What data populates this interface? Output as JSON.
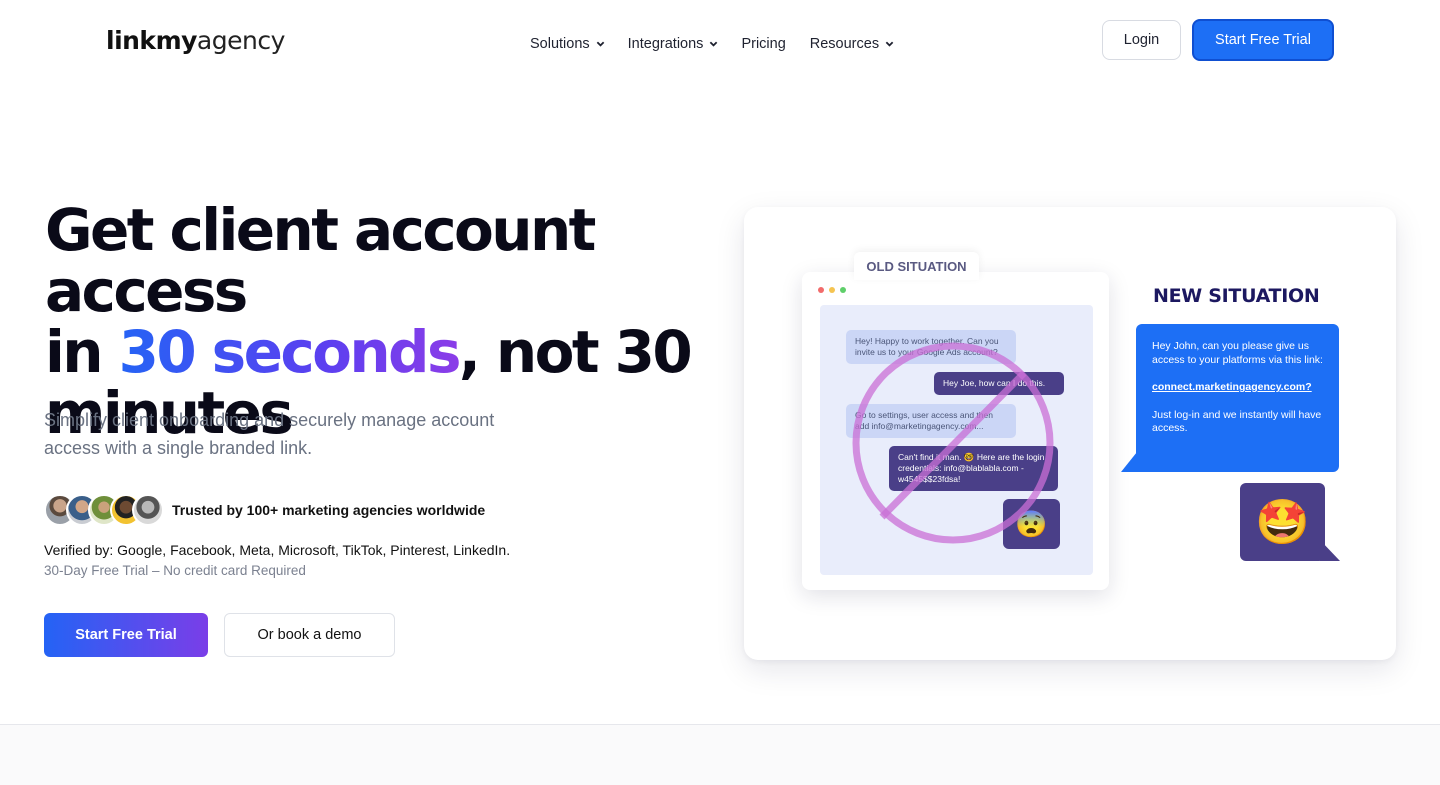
{
  "header": {
    "logo_bold": "linkmy",
    "logo_light": "agency",
    "nav": [
      {
        "label": "Solutions",
        "dropdown": true
      },
      {
        "label": "Integrations",
        "dropdown": true
      },
      {
        "label": "Pricing",
        "dropdown": false
      },
      {
        "label": "Resources",
        "dropdown": true
      }
    ],
    "login_label": "Login",
    "trial_label": "Start Free Trial"
  },
  "hero": {
    "title_line1": "Get client account access",
    "title_in": "in ",
    "title_highlight": "30 seconds",
    "title_rest": ", not 30",
    "title_line3": "minutes",
    "subtitle": "Simplify client onboarding and securely manage account access with a single branded link.",
    "trusted_text": "Trusted by 100+ marketing agencies worldwide",
    "verified_text": "Verified by: Google, Facebook, Meta, Microsoft, TikTok, Pinterest, LinkedIn.",
    "trial_note": "30-Day Free Trial – No credit card Required",
    "cta_primary": "Start Free Trial",
    "cta_secondary": "Or book a demo"
  },
  "illustration": {
    "old_label": "OLD SITUATION",
    "old_messages": [
      {
        "side": "left",
        "text": "Hey! Happy to work together. Can you invite us to your Google Ads account?"
      },
      {
        "side": "right",
        "text": "Hey Joe, how can I do this."
      },
      {
        "side": "left",
        "text": "Go to settings, user access and then add info@marketingagency.com..."
      },
      {
        "side": "right",
        "text": "Can't find it man. 🤓 Here are the login credentials: info@blablabla.com - w4545$$23fdsa!"
      }
    ],
    "old_emoji": "😨",
    "new_label": "NEW SITUATION",
    "new_msg_1": "Hey John, can you please give us access to your platforms via this link:",
    "new_link": "connect.marketingagency.com?",
    "new_msg_2": "Just log-in and we instantly will have access.",
    "new_emoji": "🤩"
  },
  "colors": {
    "primary_blue": "#1d6ff5",
    "accent_purple": "#7a3ee8",
    "dark_bubble": "#4a3f88"
  }
}
